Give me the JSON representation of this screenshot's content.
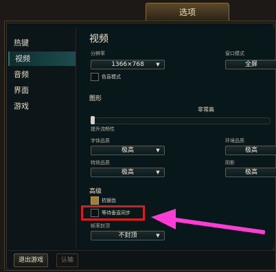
{
  "window": {
    "title": "选项"
  },
  "sidebar": {
    "items": [
      {
        "label": "热键",
        "active": false
      },
      {
        "label": "视频",
        "active": true
      },
      {
        "label": "音频",
        "active": false
      },
      {
        "label": "界面",
        "active": false
      },
      {
        "label": "游戏",
        "active": false
      }
    ]
  },
  "content": {
    "title": "视频",
    "resolution": {
      "label": "分辨率",
      "value": "1366×768"
    },
    "window_mode": {
      "label": "窗口模式",
      "value": "全屏"
    },
    "colorblind": {
      "label": "色盲模式",
      "checked": false
    },
    "graphics": {
      "title": "图形",
      "quality_value": "非常高",
      "quality_level": 0.0,
      "slider_hint": "提升流畅性"
    },
    "char_quality": {
      "label": "字体品质",
      "value": "极高"
    },
    "env_quality": {
      "label": "环境品质",
      "value": "极高"
    },
    "effects_quality": {
      "label": "特效品质",
      "value": "极高"
    },
    "shadow_quality": {
      "label": "阴影",
      "value": "极高"
    },
    "advanced": {
      "title": "高级",
      "antialias": {
        "label": "抗锯齿",
        "checked": true
      },
      "vsync": {
        "label": "等待垂直同步",
        "checked": false
      }
    },
    "frame_cap": {
      "label": "帧率封顶",
      "value": "不封顶"
    }
  },
  "bottom": {
    "exit_label": "退出游戏",
    "confirm_label": "认输"
  },
  "colors": {
    "highlight": "#d51e1e",
    "arrow": "#ff3bd6"
  }
}
